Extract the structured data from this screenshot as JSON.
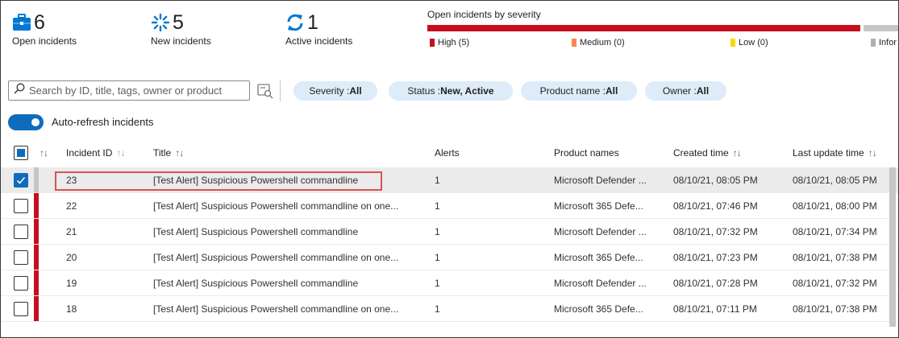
{
  "summary": {
    "open": {
      "value": "6",
      "label": "Open incidents"
    },
    "new": {
      "value": "5",
      "label": "New incidents"
    },
    "active": {
      "value": "1",
      "label": "Active incidents"
    }
  },
  "severity": {
    "title": "Open incidents by severity",
    "legend": [
      {
        "label": "High (5)",
        "color": "#c50f1f"
      },
      {
        "label": "Medium (0)",
        "color": "#f7894a"
      },
      {
        "label": "Low (0)",
        "color": "#f8d800"
      },
      {
        "label": "Infor",
        "color": "#b3b0ad"
      }
    ]
  },
  "toolbar": {
    "search_placeholder": "Search by ID, title, tags, owner or product",
    "filters": [
      {
        "key": "Severity : ",
        "value": "All"
      },
      {
        "key": "Status : ",
        "value": "New, Active"
      },
      {
        "key": "Product name : ",
        "value": "All"
      },
      {
        "key": "Owner : ",
        "value": "All"
      }
    ],
    "auto_refresh_label": "Auto-refresh incidents"
  },
  "table": {
    "columns": {
      "id": "Incident ID",
      "title": "Title",
      "alerts": "Alerts",
      "products": "Product names",
      "created": "Created time",
      "updated": "Last update time"
    },
    "sort_glyph": "↑↓",
    "rows": [
      {
        "id": "23",
        "title": "[Test Alert] Suspicious Powershell commandline",
        "alerts": "1",
        "product": "Microsoft Defender ...",
        "created": "08/10/21, 08:05 PM",
        "updated": "08/10/21, 08:05 PM"
      },
      {
        "id": "22",
        "title": "[Test Alert] Suspicious Powershell commandline on one...",
        "alerts": "1",
        "product": "Microsoft 365 Defe...",
        "created": "08/10/21, 07:46 PM",
        "updated": "08/10/21, 08:00 PM"
      },
      {
        "id": "21",
        "title": "[Test Alert] Suspicious Powershell commandline",
        "alerts": "1",
        "product": "Microsoft Defender ...",
        "created": "08/10/21, 07:32 PM",
        "updated": "08/10/21, 07:34 PM"
      },
      {
        "id": "20",
        "title": "[Test Alert] Suspicious Powershell commandline on one...",
        "alerts": "1",
        "product": "Microsoft 365 Defe...",
        "created": "08/10/21, 07:23 PM",
        "updated": "08/10/21, 07:38 PM"
      },
      {
        "id": "19",
        "title": "[Test Alert] Suspicious Powershell commandline",
        "alerts": "1",
        "product": "Microsoft Defender ...",
        "created": "08/10/21, 07:28 PM",
        "updated": "08/10/21, 07:32 PM"
      },
      {
        "id": "18",
        "title": "[Test Alert] Suspicious Powershell commandline on one...",
        "alerts": "1",
        "product": "Microsoft 365 Defe...",
        "created": "08/10/21, 07:11 PM",
        "updated": "08/10/21, 07:38 PM"
      }
    ]
  },
  "colors": {
    "accent": "#0f6cbd",
    "high": "#c50f1f",
    "selected_row": "#ebebeb",
    "pill": "#deecf9"
  }
}
